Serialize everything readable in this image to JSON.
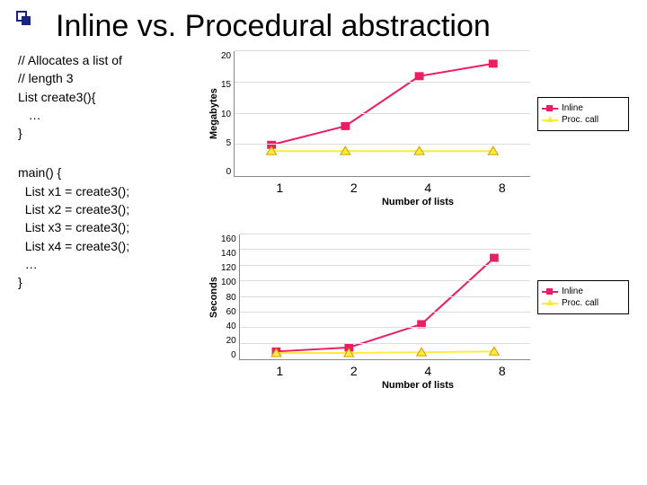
{
  "title": "Inline vs. Procedural abstraction",
  "code1": {
    "l1": "// Allocates a list of",
    "l2": "// length 3",
    "l3": "List create3(){",
    "l4": "   …",
    "l5": "}"
  },
  "code2": {
    "l1": "main() {",
    "l2": "  List x1 = create3();",
    "l3": "  List x2 = create3();",
    "l4": "  List x3 = create3();",
    "l5": "  List x4 = create3();",
    "l6": "  …",
    "l7": "}"
  },
  "legend": {
    "a": "Inline",
    "b": "Proc. call"
  },
  "chart1": {
    "ylabel": "Megabytes",
    "xlabel": "Number of lists"
  },
  "chart2": {
    "ylabel": "Seconds",
    "xlabel": "Number of lists"
  },
  "xticks": [
    "1",
    "2",
    "4",
    "8"
  ],
  "chart_data": [
    {
      "type": "line",
      "title": "",
      "xlabel": "Number of lists",
      "ylabel": "Megabytes",
      "categories": [
        "1",
        "2",
        "4",
        "8"
      ],
      "series": [
        {
          "name": "Inline",
          "values": [
            5,
            8,
            16,
            18
          ]
        },
        {
          "name": "Proc. call",
          "values": [
            4,
            4,
            4,
            4
          ]
        }
      ],
      "yticks": [
        0,
        5,
        10,
        15,
        20
      ],
      "ylim": [
        0,
        20
      ]
    },
    {
      "type": "line",
      "title": "",
      "xlabel": "Number of lists",
      "ylabel": "Seconds",
      "categories": [
        "1",
        "2",
        "4",
        "8"
      ],
      "series": [
        {
          "name": "Inline",
          "values": [
            10,
            15,
            45,
            130
          ]
        },
        {
          "name": "Proc. call",
          "values": [
            8,
            8,
            9,
            10
          ]
        }
      ],
      "yticks": [
        0,
        20,
        40,
        60,
        80,
        100,
        120,
        140,
        160
      ],
      "ylim": [
        0,
        160
      ]
    }
  ]
}
